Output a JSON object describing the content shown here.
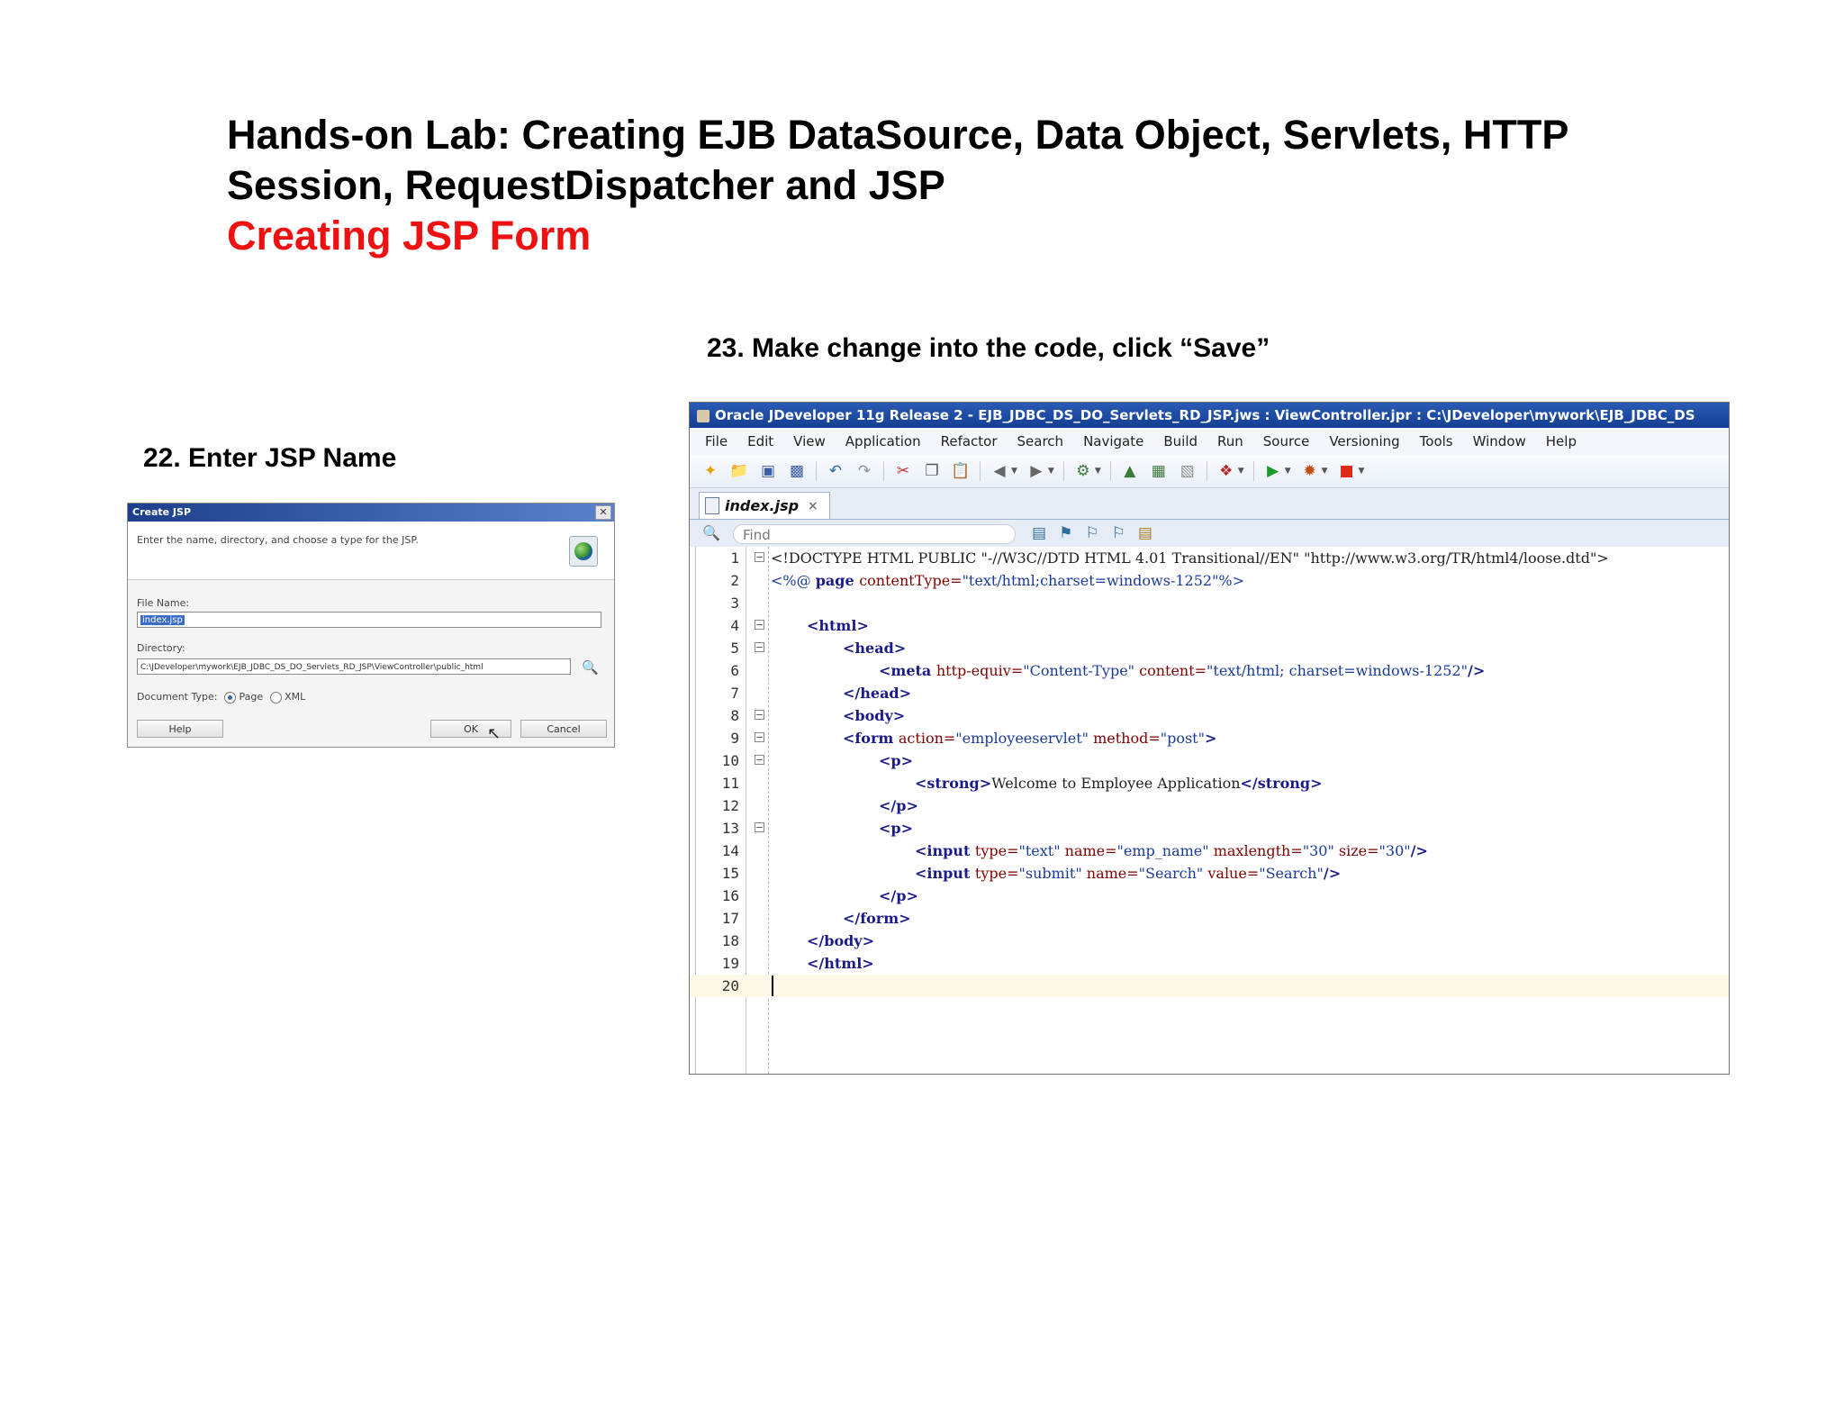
{
  "header": {
    "title_line1": "Hands-on Lab: Creating EJB DataSource, Data Object, Servlets, HTTP",
    "title_line2": "Session, RequestDispatcher and JSP",
    "subtitle": "Creating JSP Form",
    "subtitle_color": "#ee1111"
  },
  "steps": {
    "step22": "22. Enter JSP Name",
    "step23": "23. Make change into the code, click “Save”"
  },
  "dialog": {
    "title": "Create JSP",
    "description": "Enter the name, directory, and choose a type for the JSP.",
    "file_name_label": "File Name:",
    "file_name_value": "index.jsp",
    "directory_label": "Directory:",
    "directory_value": "C:\\JDeveloper\\mywork\\EJB_JDBC_DS_DO_Servlets_RD_JSP\\ViewController\\public_html",
    "document_type_label": "Document Type:",
    "radio_page": "Page",
    "radio_xml": "XML",
    "selected_type": "Page",
    "help_button": "Help",
    "ok_button": "OK",
    "cancel_button": "Cancel",
    "close_glyph": "✕"
  },
  "jdev": {
    "window_title": "Oracle JDeveloper 11g Release 2 - EJB_JDBC_DS_DO_Servlets_RD_JSP.jws : ViewController.jpr : C:\\JDeveloper\\mywork\\EJB_JDBC_DS",
    "menu": [
      "File",
      "Edit",
      "View",
      "Application",
      "Refactor",
      "Search",
      "Navigate",
      "Build",
      "Run",
      "Source",
      "Versioning",
      "Tools",
      "Window",
      "Help"
    ],
    "toolbar_icons": [
      "new-icon",
      "open-icon",
      "save-icon",
      "save-all-icon",
      "undo-icon",
      "redo-icon",
      "cut-icon",
      "copy-icon",
      "paste-icon",
      "back-icon",
      "forward-icon",
      "make-icon",
      "deploy-icon",
      "rebuild-icon",
      "clean-icon",
      "profile-icon",
      "run-icon",
      "debug-icon",
      "stop-icon"
    ],
    "tab_label": "index.jsp",
    "tab_close": "×",
    "find_placeholder": "Find",
    "code_lines": [
      {
        "n": "1",
        "fold": true,
        "indent": 0,
        "segs": [
          [
            "txt",
            "<!DOCTYPE HTML PUBLIC \"-//W3C//DTD HTML 4.01 Transitional//EN\" \"http://www.w3.org/TR/html4/loose.dtd\">"
          ]
        ]
      },
      {
        "n": "2",
        "fold": false,
        "indent": 0,
        "segs": [
          [
            "val",
            "<%@ "
          ],
          [
            "tag",
            "page "
          ],
          [
            "attr",
            "contentType="
          ],
          [
            "val",
            "\"text/html;charset=windows-1252\"%>"
          ]
        ]
      },
      {
        "n": "3",
        "fold": false,
        "indent": 0,
        "segs": []
      },
      {
        "n": "4",
        "fold": true,
        "indent": 1,
        "segs": [
          [
            "tag",
            "<html>"
          ]
        ]
      },
      {
        "n": "5",
        "fold": true,
        "indent": 2,
        "segs": [
          [
            "tag",
            "<head>"
          ]
        ]
      },
      {
        "n": "6",
        "fold": false,
        "indent": 3,
        "segs": [
          [
            "tag",
            "<meta "
          ],
          [
            "attr",
            "http-equiv="
          ],
          [
            "val",
            "\"Content-Type\" "
          ],
          [
            "attr",
            "content="
          ],
          [
            "val",
            "\"text/html; charset=windows-1252\""
          ],
          [
            "tag",
            "/>"
          ]
        ]
      },
      {
        "n": "7",
        "fold": false,
        "indent": 2,
        "segs": [
          [
            "tag",
            "</head>"
          ]
        ]
      },
      {
        "n": "8",
        "fold": true,
        "indent": 2,
        "segs": [
          [
            "tag",
            "<body>"
          ]
        ]
      },
      {
        "n": "9",
        "fold": true,
        "indent": 2,
        "segs": [
          [
            "tag",
            "<form "
          ],
          [
            "attr",
            "action="
          ],
          [
            "val",
            "\"employeeservlet\" "
          ],
          [
            "attr",
            "method="
          ],
          [
            "val",
            "\"post\""
          ],
          [
            "tag",
            ">"
          ]
        ]
      },
      {
        "n": "10",
        "fold": true,
        "indent": 3,
        "segs": [
          [
            "tag",
            "<p>"
          ]
        ]
      },
      {
        "n": "11",
        "fold": false,
        "indent": 4,
        "segs": [
          [
            "tag",
            "<strong>"
          ],
          [
            "txt",
            "Welcome to Employee Application"
          ],
          [
            "tag",
            "</strong>"
          ]
        ]
      },
      {
        "n": "12",
        "fold": false,
        "indent": 3,
        "segs": [
          [
            "tag",
            "</p>"
          ]
        ]
      },
      {
        "n": "13",
        "fold": true,
        "indent": 3,
        "segs": [
          [
            "tag",
            "<p>"
          ]
        ]
      },
      {
        "n": "14",
        "fold": false,
        "indent": 4,
        "segs": [
          [
            "tag",
            "<input "
          ],
          [
            "attr",
            "type="
          ],
          [
            "val",
            "\"text\" "
          ],
          [
            "attr",
            "name="
          ],
          [
            "val",
            "\"emp_name\" "
          ],
          [
            "attr",
            "maxlength="
          ],
          [
            "val",
            "\"30\" "
          ],
          [
            "attr",
            "size="
          ],
          [
            "val",
            "\"30\""
          ],
          [
            "tag",
            "/>"
          ]
        ]
      },
      {
        "n": "15",
        "fold": false,
        "indent": 4,
        "segs": [
          [
            "tag",
            "<input "
          ],
          [
            "attr",
            "type="
          ],
          [
            "val",
            "\"submit\" "
          ],
          [
            "attr",
            "name="
          ],
          [
            "val",
            "\"Search\" "
          ],
          [
            "attr",
            "value="
          ],
          [
            "val",
            "\"Search\""
          ],
          [
            "tag",
            "/>"
          ]
        ]
      },
      {
        "n": "16",
        "fold": false,
        "indent": 3,
        "segs": [
          [
            "tag",
            "</p>"
          ]
        ]
      },
      {
        "n": "17",
        "fold": false,
        "indent": 2,
        "segs": [
          [
            "tag",
            "</form>"
          ]
        ]
      },
      {
        "n": "18",
        "fold": false,
        "indent": 1,
        "segs": [
          [
            "tag",
            "</body>"
          ]
        ]
      },
      {
        "n": "19",
        "fold": false,
        "indent": 1,
        "segs": [
          [
            "tag",
            "</html>"
          ]
        ]
      },
      {
        "n": "20",
        "fold": false,
        "indent": 0,
        "segs": [],
        "current": true
      }
    ]
  }
}
